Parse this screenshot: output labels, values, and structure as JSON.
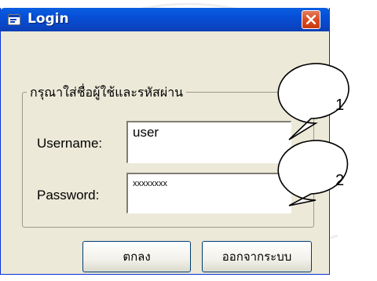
{
  "window": {
    "title": "Login",
    "close_label": "Close"
  },
  "form": {
    "group_title": "กรุณาใส่ชื่อผู้ใช้และรหัสผ่าน",
    "username_label": "Username:",
    "username_value": "user",
    "password_label": "Password:",
    "password_value": "xxxxxxxx"
  },
  "buttons": {
    "ok_label": "ตกลง",
    "exit_label": "ออกจากระบบ"
  },
  "callouts": {
    "first": "1",
    "second": "2"
  },
  "colors": {
    "titlebar": "#0a5fe0",
    "window_bg": "#ece9d8",
    "close_button": "#d9491f"
  }
}
